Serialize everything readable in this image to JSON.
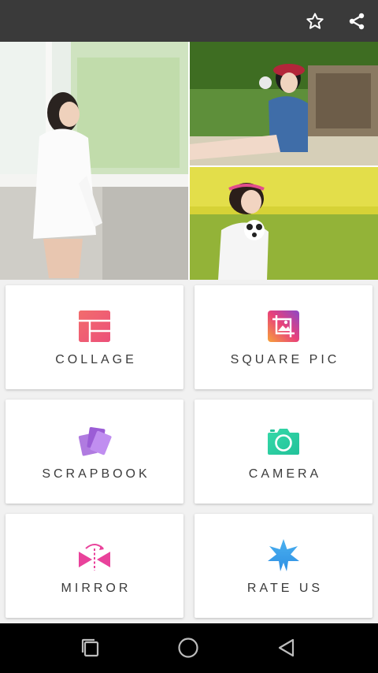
{
  "toolbar": {
    "favorite_icon": "star-outline-icon",
    "share_icon": "share-icon"
  },
  "hero_collage": {
    "photos": [
      {
        "description_icon": "photo-window-girl"
      },
      {
        "description_icon": "photo-girl-pinwheel"
      },
      {
        "description_icon": "photo-girl-flower-field"
      }
    ]
  },
  "menu": {
    "items": [
      {
        "label": "COLLAGE",
        "icon": "collage-layout-icon",
        "color": "#f0566a"
      },
      {
        "label": "SQUARE PIC",
        "icon": "square-crop-icon",
        "color": "#c5409d"
      },
      {
        "label": "SCRAPBOOK",
        "icon": "scrapbook-cards-icon",
        "color": "#9b5dd6"
      },
      {
        "label": "CAMERA",
        "icon": "camera-icon",
        "color": "#2fcfa3"
      },
      {
        "label": "MIRROR",
        "icon": "mirror-icon",
        "color": "#e9429b"
      },
      {
        "label": "RATE US",
        "icon": "rate-star-icon",
        "color": "#3da0ea"
      }
    ]
  },
  "system_nav": {
    "recents_icon": "recents-square-icon",
    "home_icon": "home-circle-icon",
    "back_icon": "back-triangle-icon"
  }
}
